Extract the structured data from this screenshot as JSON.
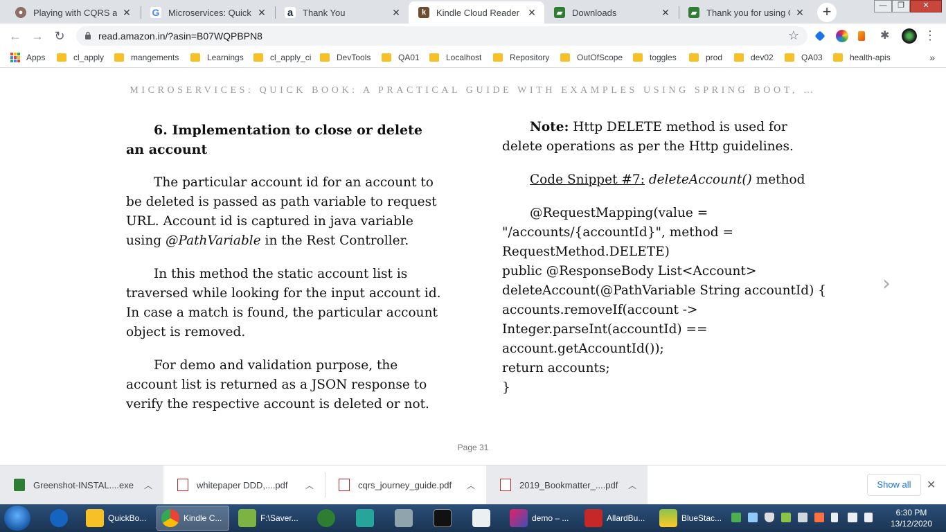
{
  "browser": {
    "tabs": [
      {
        "title": "Playing with CQRS and E",
        "favicon": "avatar-icon",
        "color": "#8d6e63"
      },
      {
        "title": "Microservices: Quick Boo",
        "favicon": "google-icon",
        "color": "#4285f4"
      },
      {
        "title": "Thank You",
        "favicon": "amazon-icon",
        "color": "#232f3e"
      },
      {
        "title": "Kindle Cloud Reader",
        "favicon": "kindle-icon",
        "color": "#6d4c2f",
        "active": true
      },
      {
        "title": "Downloads",
        "favicon": "greenshot-icon",
        "color": "#2e7d32"
      },
      {
        "title": "Thank you for using Gre",
        "favicon": "greenshot-icon",
        "color": "#2e7d32"
      }
    ],
    "url": "read.amazon.in/?asin=B07WQPBPN8",
    "bookmarks": [
      {
        "label": "Apps",
        "type": "apps"
      },
      {
        "label": "cl_apply"
      },
      {
        "label": "mangements"
      },
      {
        "label": "Learnings"
      },
      {
        "label": "cl_apply_ci"
      },
      {
        "label": "DevTools"
      },
      {
        "label": "QA01"
      },
      {
        "label": "Localhost"
      },
      {
        "label": "Repository"
      },
      {
        "label": "OutOfScope"
      },
      {
        "label": "toggles"
      },
      {
        "label": "prod"
      },
      {
        "label": "dev02"
      },
      {
        "label": "QA03"
      },
      {
        "label": "health-apis"
      }
    ],
    "bookmarks_more": "»",
    "window_controls": {
      "minimize": "—",
      "maximize": "❐",
      "close": "✕"
    }
  },
  "reader": {
    "book_title": "MICROSERVICES: QUICK BOOK: A PRACTICAL GUIDE WITH EXAMPLES USING SPRING BOOT, …",
    "heading": "6. Implementation to close or delete an account",
    "para1_a": "The particular account id for an account to be deleted is passed as path variable to request URL. Account id is captured in java variable using ",
    "para1_em": "@PathVariable",
    "para1_b": " in the Rest Controller.",
    "para2": "In this method the static account list is traversed while looking for the input account id. In case a match is found, the particular account object is removed.",
    "para3": "For demo and validation purpose, the account list is returned as a JSON response to verify the respective account is deleted or not.",
    "note_label": "Note:",
    "note_text": " Http DELETE method is used for delete operations as per the Http guidelines.",
    "snippet_label": "Code Snippet #7:",
    "snippet_method": "deleteAccount()",
    "snippet_suffix": " method",
    "code": {
      "line1": "@RequestMapping(value =",
      "line2": "\"/accounts/{accountId}\", method =",
      "line3": "RequestMethod.DELETE)",
      "line4": "public @ResponseBody List<Account>",
      "line5": "deleteAccount(@PathVariable String accountId) {",
      "line6": "accounts.removeIf(account ->",
      "line7": "Integer.parseInt(accountId) ==",
      "line8": "account.getAccountId());",
      "line9": "return accounts;",
      "line10": "}"
    },
    "next_arrow": "›",
    "page": "Page 31"
  },
  "downloads": {
    "items": [
      {
        "name": "Greenshot-INSTAL....exe",
        "icon": "greenshot-icon"
      },
      {
        "name": "whitepaper DDD,....pdf",
        "icon": "pdf-icon"
      },
      {
        "name": "cqrs_journey_guide.pdf",
        "icon": "pdf-icon"
      },
      {
        "name": "2019_Bookmatter_....pdf",
        "icon": "pdf-icon"
      }
    ],
    "show_all": "Show all",
    "close": "✕"
  },
  "taskbar": {
    "items": [
      {
        "label": "QuickBo...",
        "icon": "folder-icon"
      },
      {
        "label": "Kindle C...",
        "icon": "chrome-icon",
        "active": true
      },
      {
        "label": "F:\\Saver...",
        "icon": "notepad-icon"
      },
      {
        "label": "demo – ...",
        "icon": "intellij-icon"
      },
      {
        "label": "AllardBu...",
        "icon": "pdf-icon"
      },
      {
        "label": "BlueStac...",
        "icon": "bluestacks-icon"
      }
    ],
    "time": "6:30 PM",
    "date": "13/12/2020"
  }
}
